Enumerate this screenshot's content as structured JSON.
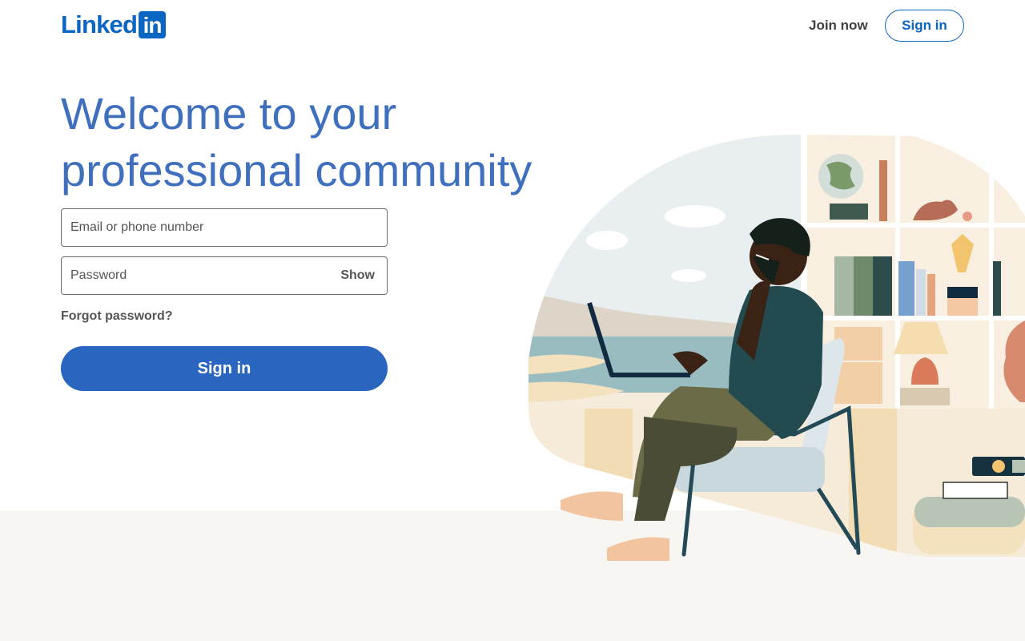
{
  "header": {
    "logo_text": "Linked",
    "logo_box_text": "in",
    "join_now": "Join now",
    "sign_in": "Sign in"
  },
  "hero": {
    "headline": "Welcome to your professional community"
  },
  "form": {
    "email_placeholder": "Email or phone number",
    "password_placeholder": "Password",
    "show_label": "Show",
    "forgot_password": "Forgot password?",
    "sign_in_button": "Sign in"
  },
  "colors": {
    "brand_blue": "#0a66c2",
    "headline_blue": "#3f6fbd",
    "button_blue": "#2a66bf",
    "bottom_band": "#f8f6f3"
  },
  "icons": {
    "logo": "linkedin-logo-icon"
  }
}
